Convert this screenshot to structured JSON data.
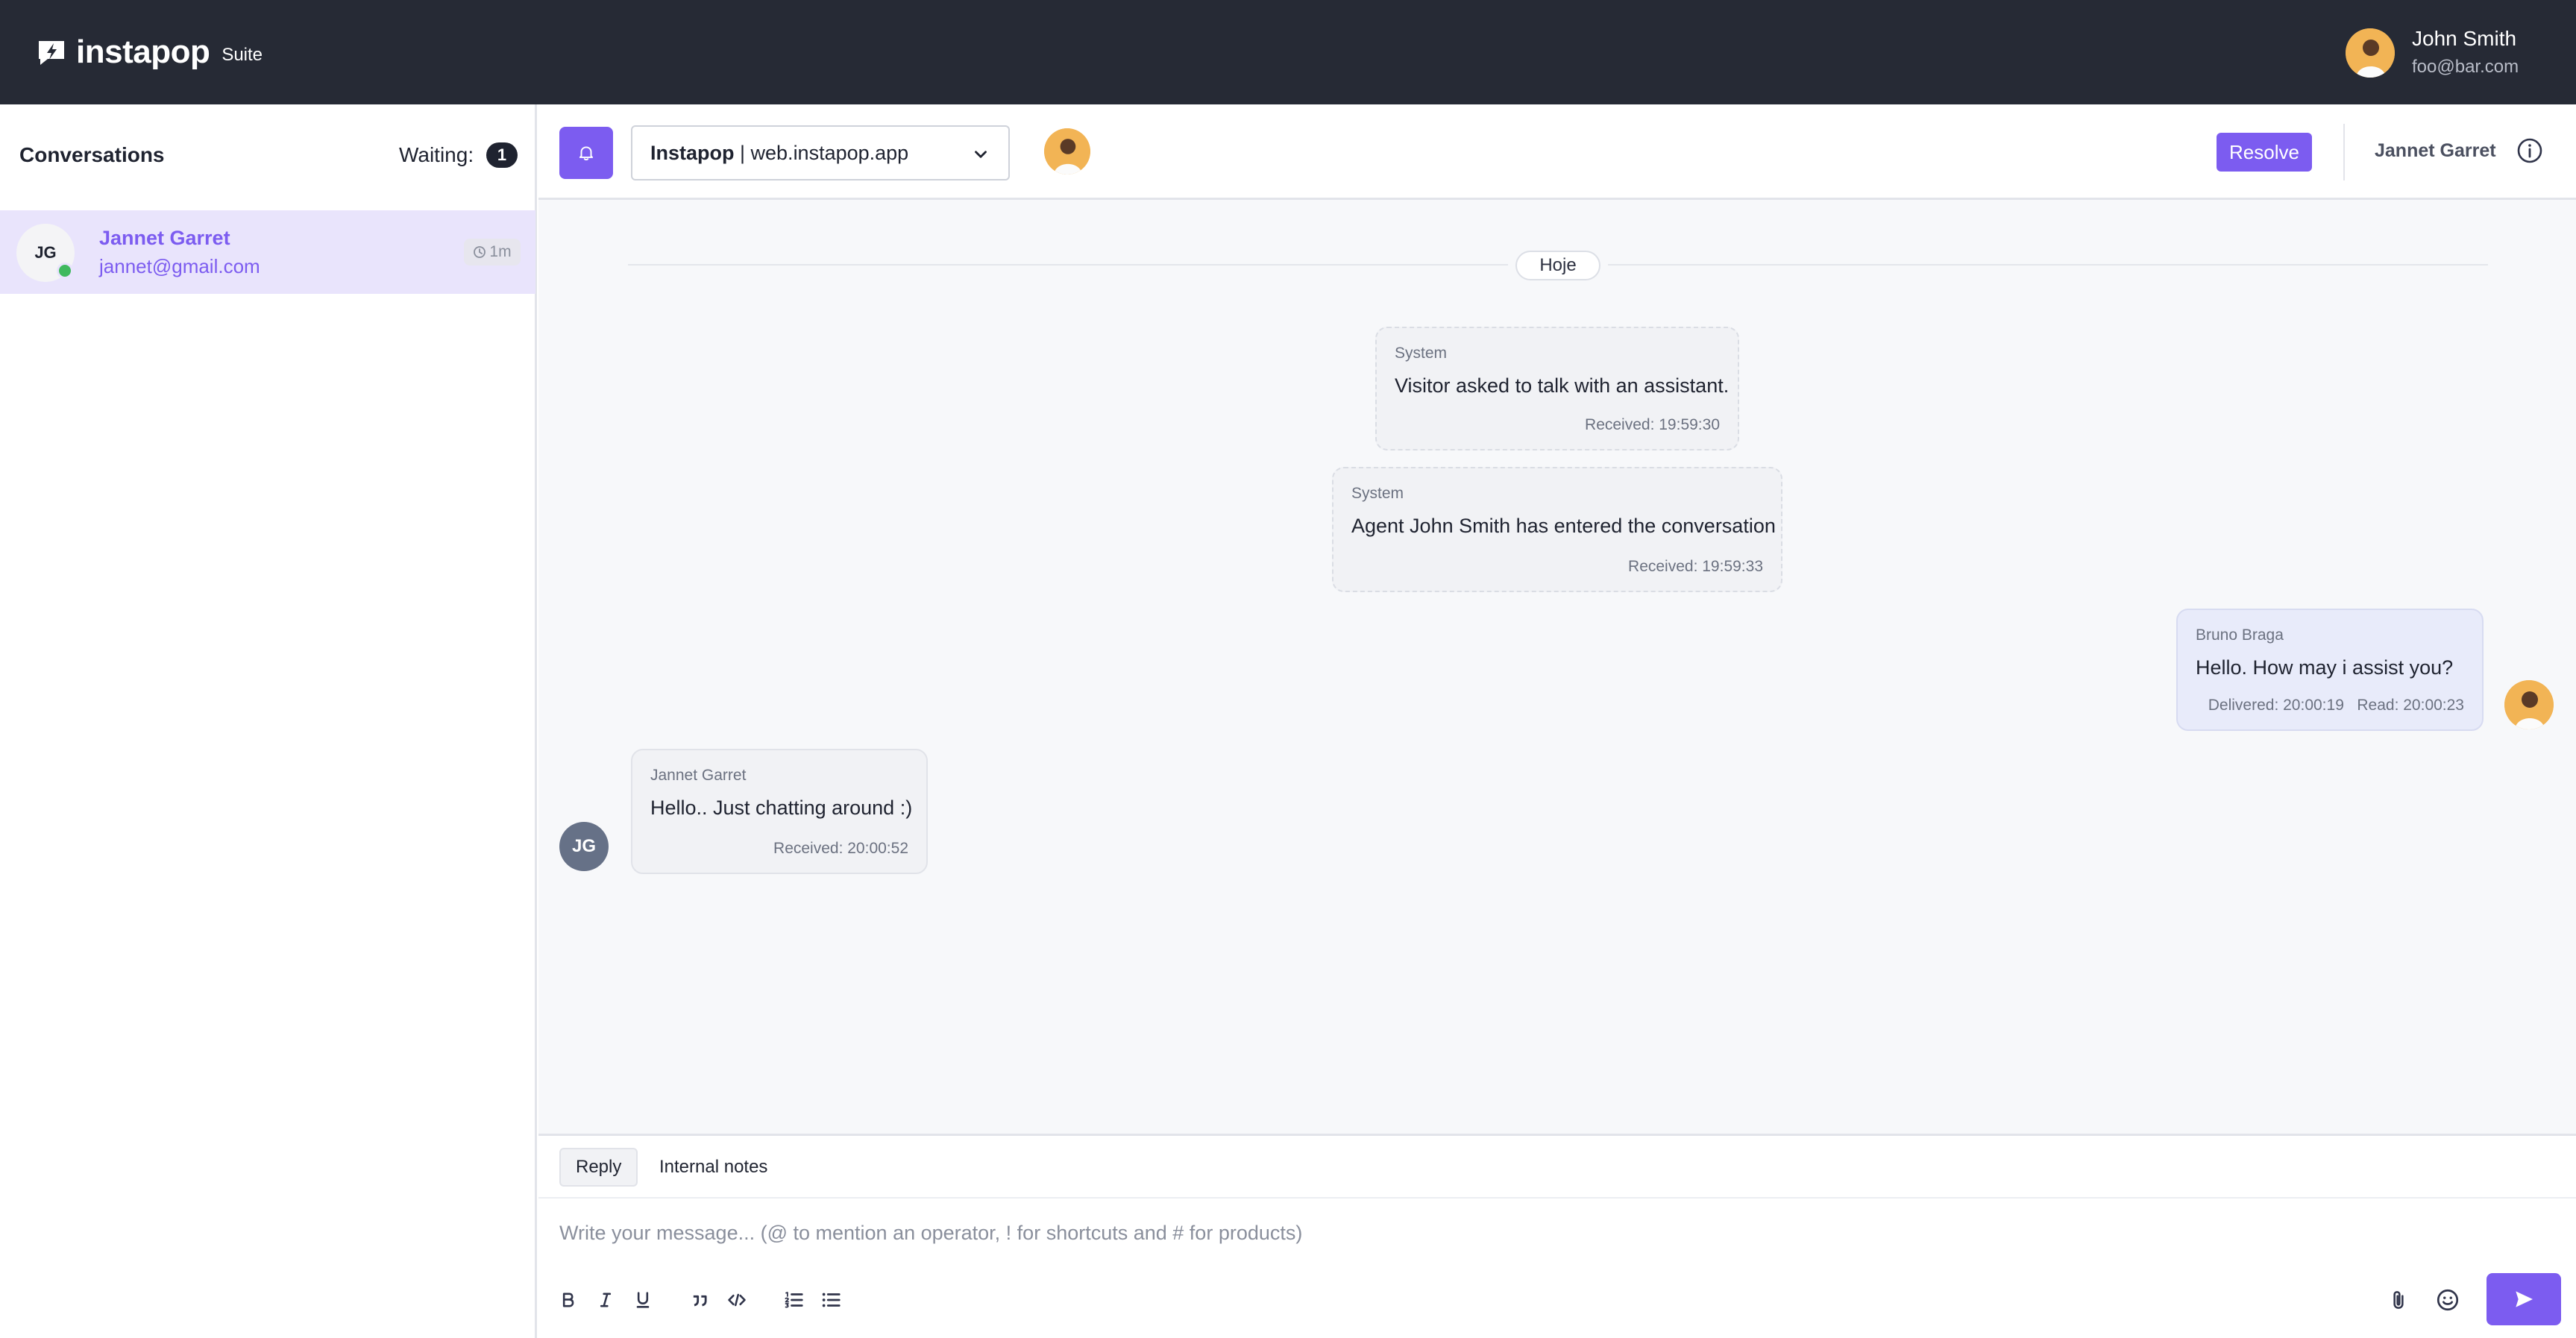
{
  "app": {
    "brand": "instapop",
    "suite_label": "Suite",
    "accent_color": "#7c5cf0",
    "topbar_color": "#262a35"
  },
  "user": {
    "name": "John Smith",
    "email": "foo@bar.com"
  },
  "sidebar": {
    "title": "Conversations",
    "waiting_label": "Waiting:",
    "waiting_count": "1",
    "conversations": [
      {
        "initials": "JG",
        "name": "Jannet Garret",
        "email": "jannet@gmail.com",
        "elapsed": "1m",
        "status": "online"
      }
    ]
  },
  "header": {
    "channel_name": "Instapop",
    "channel_separator": " | ",
    "channel_url": "web.instapop.app",
    "resolve_label": "Resolve",
    "contact_name": "Jannet Garret"
  },
  "chat": {
    "date_label": "Hoje",
    "messages": [
      {
        "sender": "System",
        "text": "Visitor asked to talk with an assistant.",
        "meta": "Received: 19:59:30"
      },
      {
        "sender": "System",
        "text": "Agent John Smith has entered the conversation",
        "meta": "Received: 19:59:33"
      },
      {
        "sender": "Bruno Braga",
        "text": "Hello. How may i assist you?",
        "meta": "Delivered: 20:00:19   Read: 20:00:23"
      },
      {
        "sender": "Jannet Garret",
        "text": "Hello.. Just chatting around :)",
        "meta": "Received: 20:00:52"
      }
    ],
    "customer_initials": "JG"
  },
  "composer": {
    "tabs": [
      {
        "label": "Reply",
        "active": true
      },
      {
        "label": "Internal notes",
        "active": false
      }
    ],
    "placeholder": "Write your message... (@ to mention an operator, ! for shortcuts and # for products)",
    "value": "",
    "tools": [
      "bold-icon",
      "italic-icon",
      "underline-icon",
      "quote-icon",
      "code-icon",
      "ordered-list-icon",
      "bullet-list-icon"
    ],
    "attach_icon": "paperclip-icon",
    "emoji_icon": "smile-icon",
    "send_icon": "send-icon"
  }
}
